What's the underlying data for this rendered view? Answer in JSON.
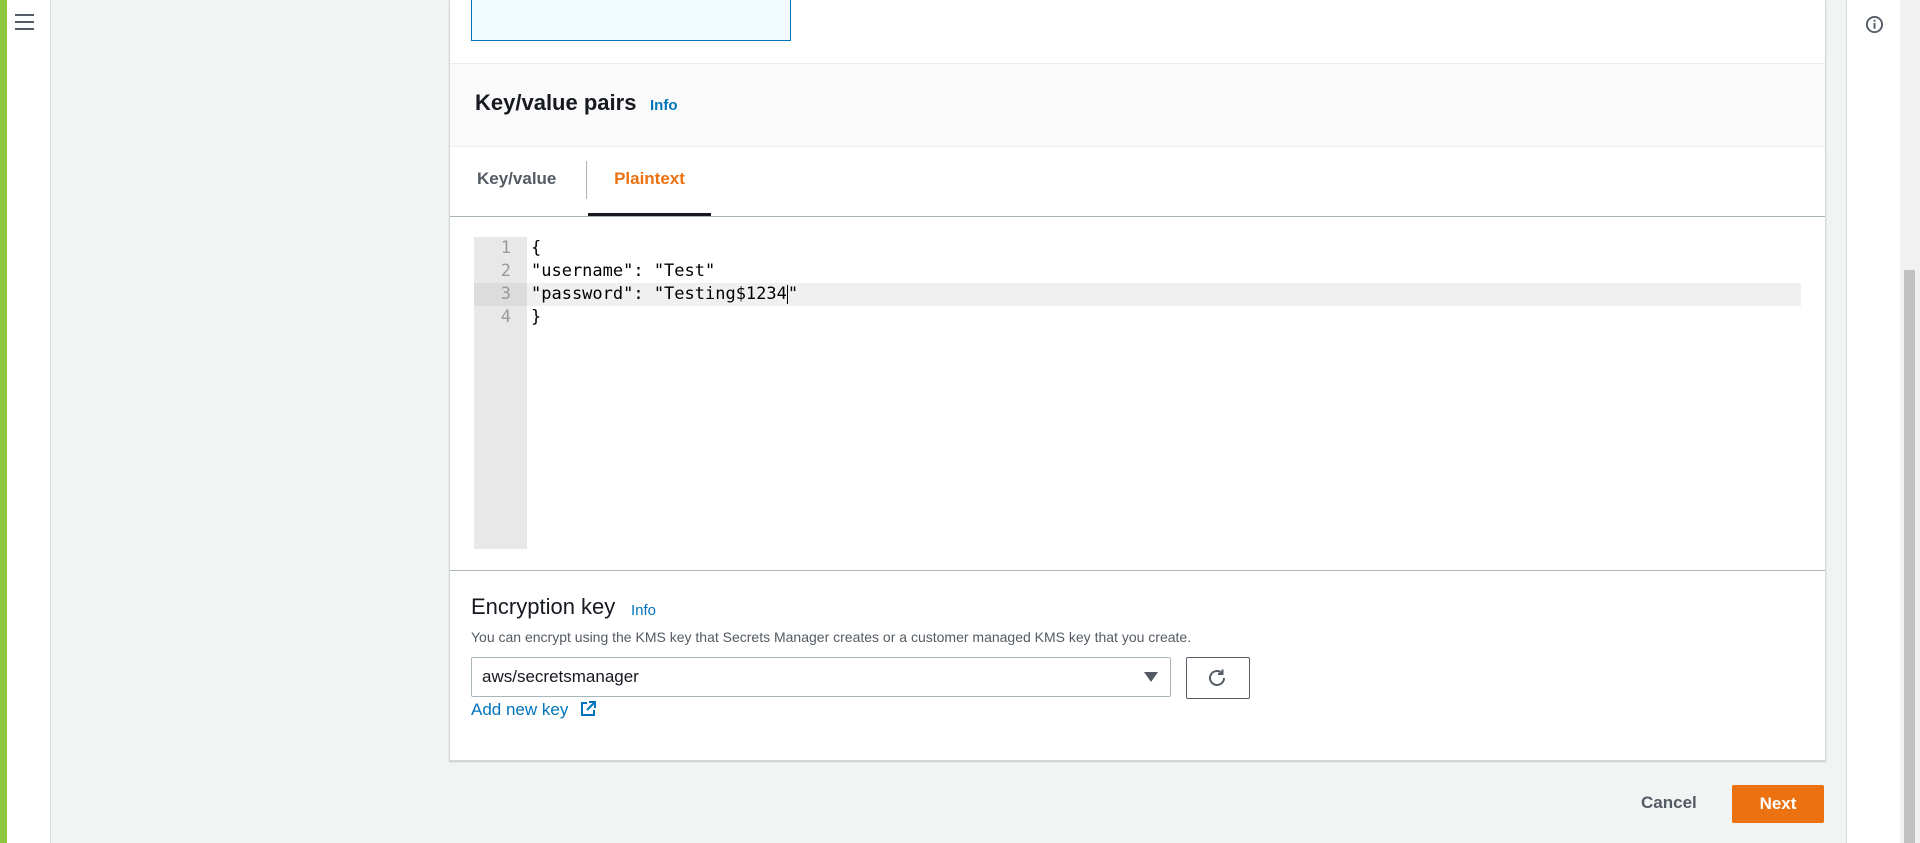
{
  "nav": {
    "menu_icon": "hamburger-icon"
  },
  "help_panel": {
    "icon": "info-circle-icon"
  },
  "kv_section": {
    "title": "Key/value pairs",
    "info_label": "Info",
    "tabs": [
      {
        "label": "Key/value",
        "active": false
      },
      {
        "label": "Plaintext",
        "active": true
      }
    ]
  },
  "editor": {
    "lines": [
      {
        "number": "1",
        "text": "{"
      },
      {
        "number": "2",
        "text": "\"username\": \"Test\""
      },
      {
        "number": "3",
        "text": "\"password\": \"Testing$1234\""
      },
      {
        "number": "4",
        "text": "}"
      }
    ],
    "active_line": 3
  },
  "encryption": {
    "title": "Encryption key",
    "info_label": "Info",
    "description": "You can encrypt using the KMS key that Secrets Manager creates or a customer managed KMS key that you create.",
    "selected_key": "aws/secretsmanager",
    "refresh_icon": "refresh-icon",
    "add_key_label": "Add new key",
    "add_key_icon": "external-link-icon"
  },
  "footer": {
    "cancel_label": "Cancel",
    "next_label": "Next"
  },
  "colors": {
    "accent": "#ec7211",
    "link": "#0073bb",
    "frame": "#8dc63f"
  }
}
